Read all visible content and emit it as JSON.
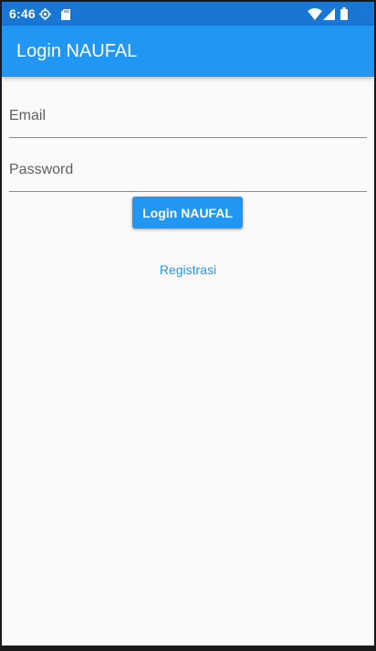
{
  "status_bar": {
    "time": "6:46",
    "icons": [
      "settings-gear-icon",
      "sd-card-icon",
      "wifi-icon",
      "signal-icon",
      "battery-icon"
    ],
    "background": "#1976d2"
  },
  "app_bar": {
    "title": "Login NAUFAL",
    "background": "#2196f3"
  },
  "form": {
    "email": {
      "placeholder": "Email",
      "value": ""
    },
    "password": {
      "placeholder": "Password",
      "value": ""
    },
    "login_button_label": "Login NAUFAL",
    "register_link_label": "Registrasi"
  },
  "colors": {
    "accent": "#2196f3",
    "status_bar": "#1976d2",
    "background": "#fafafa",
    "underline": "#8a8a8a"
  }
}
